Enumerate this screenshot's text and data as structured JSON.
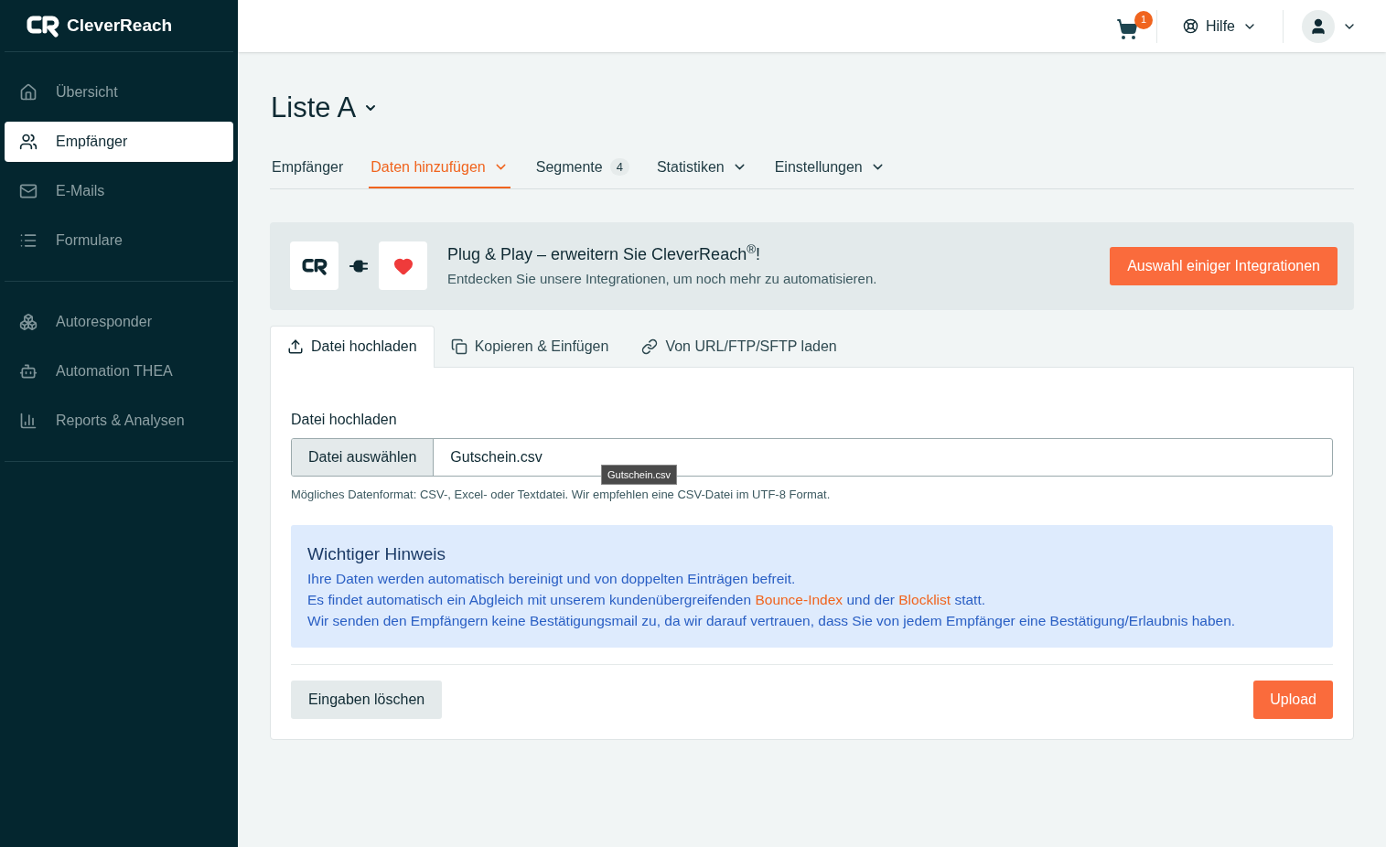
{
  "sidebar": {
    "brand": "CleverReach",
    "groups": [
      [
        {
          "label": "Übersicht",
          "selected": false
        },
        {
          "label": "Empfänger",
          "selected": true
        },
        {
          "label": "E-Mails",
          "selected": false
        },
        {
          "label": "Formulare",
          "selected": false
        }
      ],
      [
        {
          "label": "Autoresponder",
          "selected": false
        },
        {
          "label": "Automation THEA",
          "selected": false
        },
        {
          "label": "Reports & Analysen",
          "selected": false
        }
      ]
    ]
  },
  "topbar": {
    "cart_badge": "1",
    "help": "Hilfe"
  },
  "page_title": "Liste A",
  "tabs": [
    {
      "label": "Empfänger",
      "selected": false,
      "has_menu": false
    },
    {
      "label": "Daten hinzufügen",
      "selected": true,
      "has_menu": true
    },
    {
      "label": "Segmente",
      "selected": false,
      "has_menu": false,
      "badge": "4"
    },
    {
      "label": "Statistiken",
      "selected": false,
      "has_menu": true
    },
    {
      "label": "Einstellungen",
      "selected": false,
      "has_menu": true
    }
  ],
  "banner": {
    "title": "Plug & Play – erweitern Sie CleverReach$^{®}$!",
    "subtitle": "Entdecken Sie unsere Integrationen, um noch mehr zu automatisieren.",
    "button": "Auswahl einiger Integrationen"
  },
  "upload_tabs": [
    {
      "label": "Datei hochladen",
      "selected": true
    },
    {
      "label": "Kopieren & Einfügen",
      "selected": false
    },
    {
      "label": "Von URL/FTP/SFTP laden",
      "selected": false
    }
  ],
  "form": {
    "label": "Datei hochladen",
    "choose_button": "Datei auswählen",
    "value": "Gutschein.csv",
    "tooltip": "Gutschein.csv",
    "help": "Mögliches Datenformat: CSV-, Excel- oder Textdatei. Wir empfehlen eine CSV-Datei im UTF-8 Format."
  },
  "notice": {
    "title": "Wichtiger Hinweis",
    "lines": [
      [
        {
          "kind": "text",
          "text": "Ihre Daten werden automatisch bereinigt und von doppelten Einträgen befreit."
        }
      ],
      [
        {
          "kind": "text",
          "text": "Es findet automatisch ein Abgleich mit unserem kundenübergreifenden "
        },
        {
          "kind": "link",
          "text": "Bounce-Index"
        },
        {
          "kind": "text",
          "text": " und der "
        },
        {
          "kind": "link",
          "text": "Blocklist"
        },
        {
          "kind": "text",
          "text": " statt."
        }
      ],
      [
        {
          "kind": "text",
          "text": "Wir senden den Empfängern keine Bestätigungsmail zu, da wir darauf vertrauen, dass Sie von jedem Empfänger eine Bestätigung/Erlaubnis haben."
        }
      ]
    ]
  },
  "actions": {
    "clear": "Eingaben löschen",
    "upload": "Upload"
  }
}
